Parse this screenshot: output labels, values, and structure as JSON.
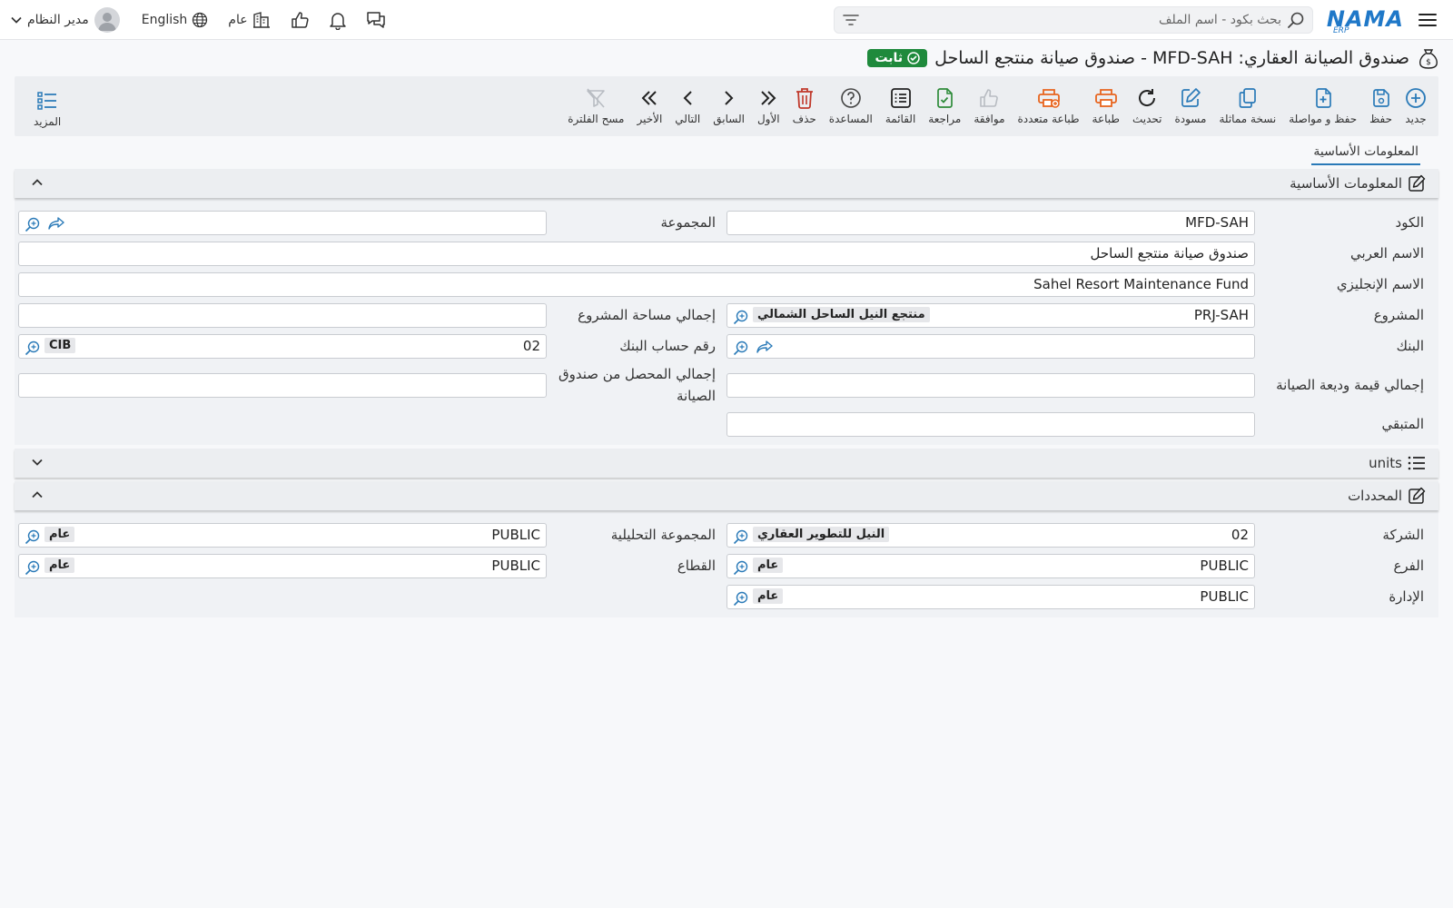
{
  "header": {
    "logo_text": "NAMA",
    "logo_sub": "ERP",
    "search_placeholder": "بحث بكود - اسم الملف",
    "user_name": "مدير النظام",
    "language": "English",
    "company": "عام"
  },
  "title": {
    "text": "صندوق الصيانة العقاري: MFD-SAH - صندوق صيانة منتجع الساحل",
    "status": "ثابت"
  },
  "toolbar": {
    "new": "جديد",
    "save": "حفظ",
    "save_continue": "حفظ و مواصلة",
    "duplicate": "نسخة مماثلة",
    "draft": "مسودة",
    "refresh": "تحديث",
    "print": "طباعة",
    "multi_print": "طباعة متعددة",
    "approve": "موافقة",
    "review": "مراجعة",
    "list": "القائمة",
    "help": "المساعدة",
    "delete": "حذف",
    "first": "الأول",
    "previous": "السابق",
    "next": "التالي",
    "last": "الأخير",
    "clear_filter": "مسح الفلترة",
    "more": "المزيد"
  },
  "tabs": {
    "basic": "المعلومات الأساسية"
  },
  "basic_panel": {
    "title": "المعلومات الأساسية",
    "code_label": "الكود",
    "code_value": "MFD-SAH",
    "group_label": "المجموعة",
    "arabic_name_label": "الاسم العربي",
    "arabic_name_value": "صندوق صيانة منتجع الساحل",
    "english_name_label": "الاسم الإنجليزي",
    "english_name_value": "Sahel Resort Maintenance Fund",
    "project_label": "المشروع",
    "project_code": "PRJ-SAH",
    "project_name": "منتجع النيل الساحل الشمالي",
    "project_area_label": "إجمالي مساحة المشروع",
    "bank_label": "البنك",
    "bank_account_label": "رقم حساب البنك",
    "bank_account_code": "02",
    "bank_account_name": "CIB",
    "deposit_total_label": "إجمالي قيمة وديعة الصيانة",
    "collected_total_label": "إجمالي المحصل من صندوق الصيانة",
    "remaining_label": "المتبقي"
  },
  "units_panel": {
    "title": "units"
  },
  "dimensions_panel": {
    "title": "المحددات",
    "company_label": "الشركة",
    "company_code": "02",
    "company_name": "النيل للتطوير العقاري",
    "analytic_group_label": "المجموعة التحليلية",
    "analytic_group_code": "PUBLIC",
    "analytic_group_name": "عام",
    "branch_label": "الفرع",
    "branch_code": "PUBLIC",
    "branch_name": "عام",
    "sector_label": "القطاع",
    "sector_code": "PUBLIC",
    "sector_name": "عام",
    "department_label": "الإدارة",
    "department_code": "PUBLIC",
    "department_name": "عام"
  },
  "colors": {
    "accent": "#2a7ab8",
    "status_green": "#1f8a3c",
    "print_orange": "#e8641e",
    "delete_red": "#c0392b",
    "review_green": "#2e8b3a"
  },
  "icons": [
    "menu-icon",
    "search-icon",
    "filter-icon",
    "chat-icon",
    "bell-icon",
    "like-icon",
    "building-icon",
    "globe-icon",
    "chevron-down-icon",
    "plus-icon",
    "save-icon",
    "save-add-icon",
    "copy-icon",
    "edit-icon",
    "refresh-icon",
    "print-icon",
    "multi-print-icon",
    "thumb-up-icon",
    "check-doc-icon",
    "list-icon",
    "help-icon",
    "trash-icon",
    "double-left-icon",
    "left-icon",
    "right-icon",
    "double-right-icon",
    "filter-clear-icon",
    "more-list-icon",
    "lookup-icon",
    "share-icon",
    "edit-square-icon"
  ]
}
